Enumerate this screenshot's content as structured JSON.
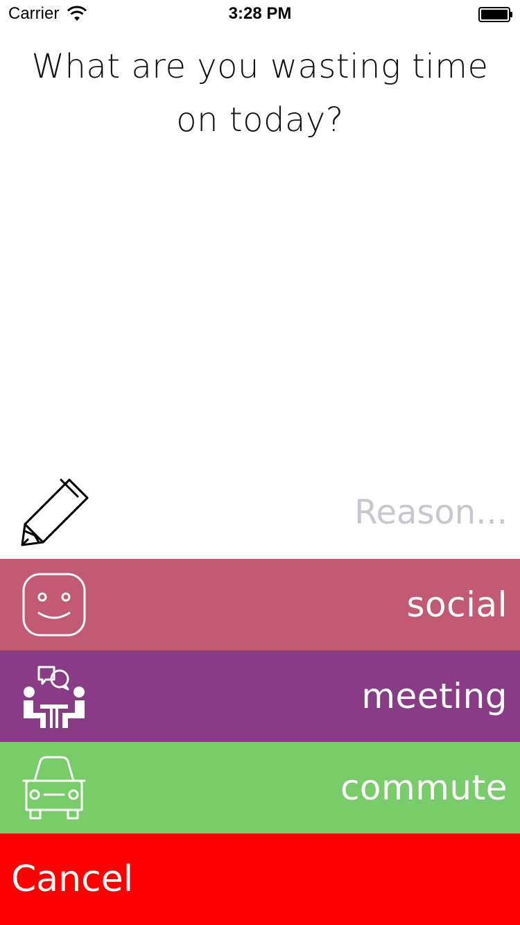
{
  "status_bar": {
    "carrier": "Carrier",
    "time": "3:28 PM",
    "wifi_icon": "wifi-icon",
    "battery_icon": "battery-icon"
  },
  "question": {
    "line1": "What are you wasting time",
    "line2": "on today?"
  },
  "reason": {
    "icon": "pencil-icon",
    "placeholder": "Reason...",
    "value": ""
  },
  "categories": [
    {
      "label": "social",
      "icon": "smiley-icon",
      "color": "#c35a74"
    },
    {
      "label": "meeting",
      "icon": "meeting-icon",
      "color": "#883c86"
    },
    {
      "label": "commute",
      "icon": "car-icon",
      "color": "#78cd6a"
    }
  ],
  "cancel": {
    "label": "Cancel",
    "color": "#ff0000"
  }
}
